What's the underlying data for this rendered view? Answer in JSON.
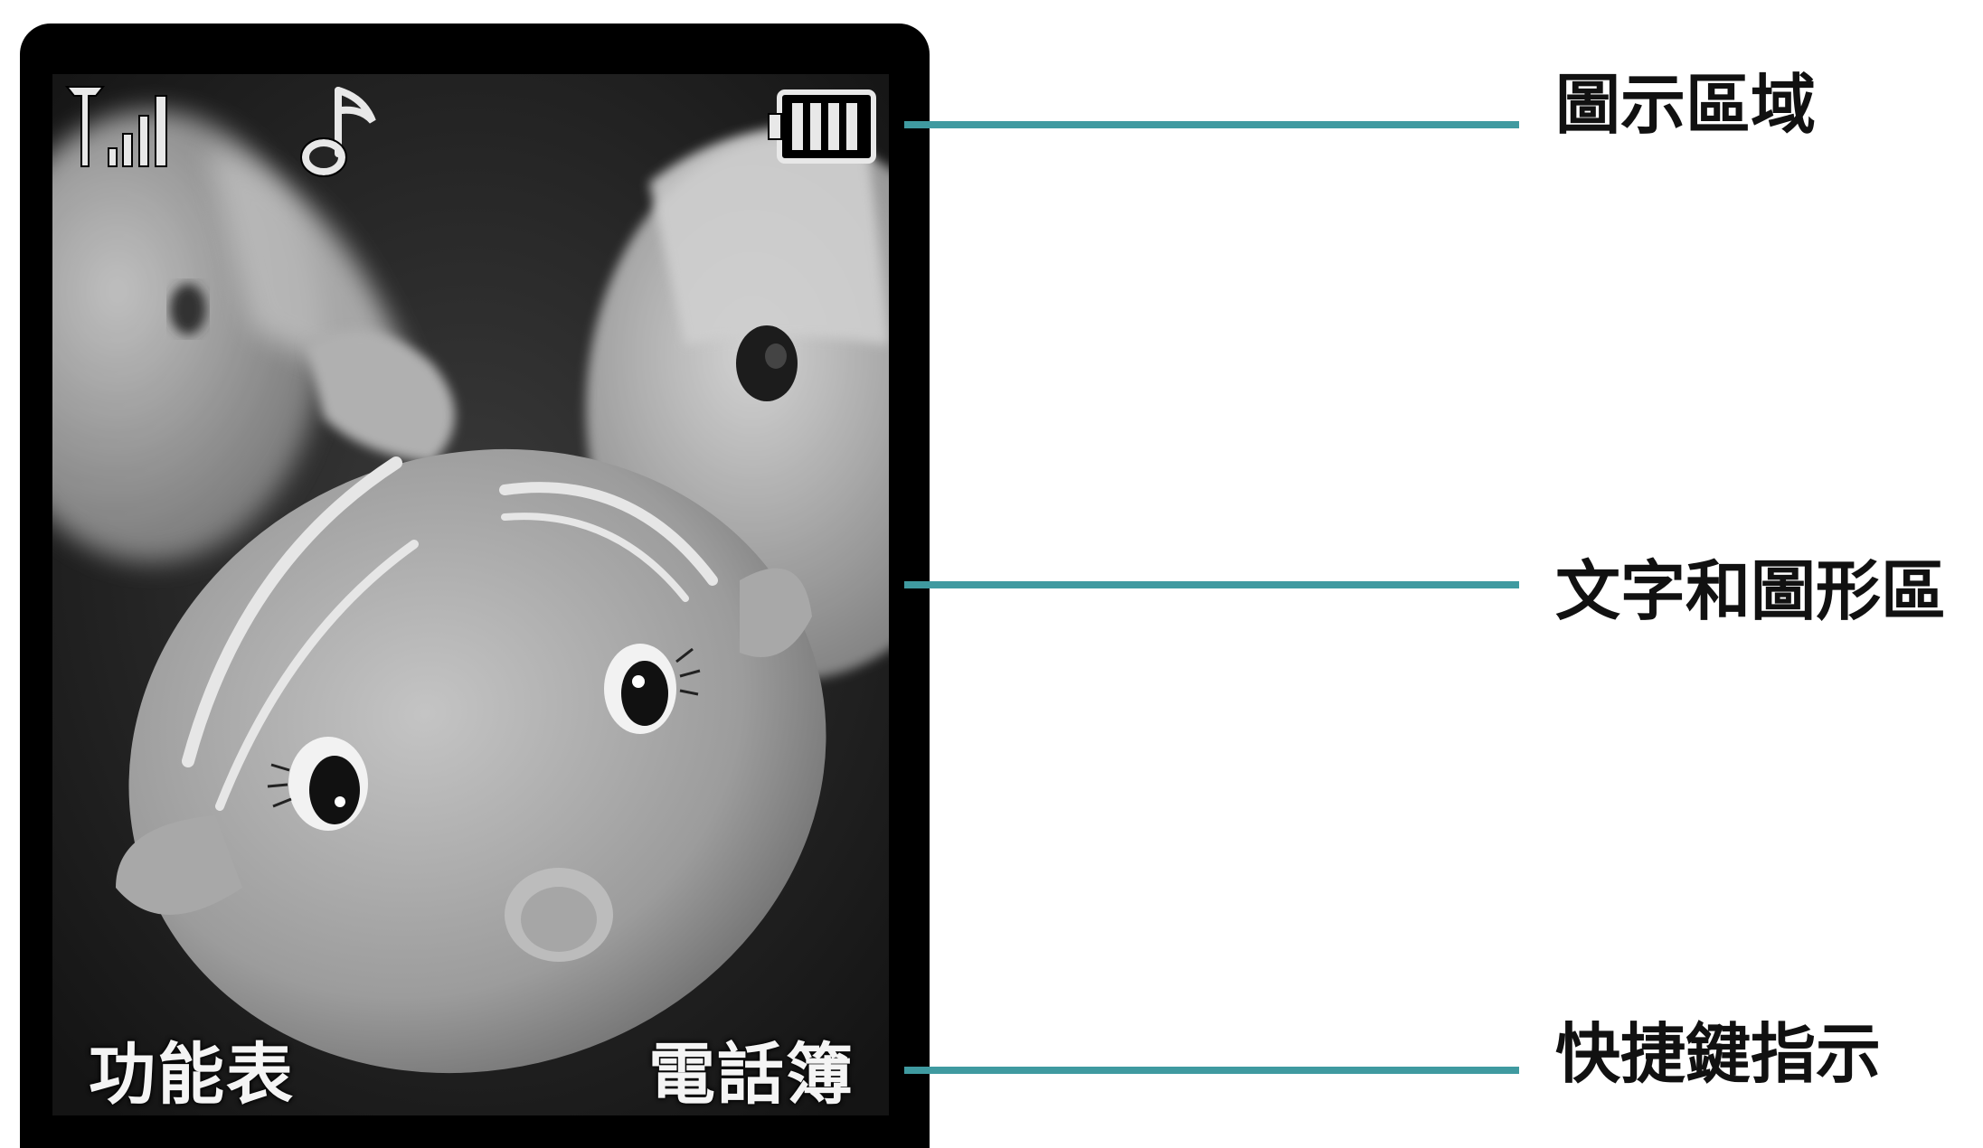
{
  "status_bar": {
    "signal_icon": "signal-strength-icon",
    "ringtone_icon": "music-note-icon",
    "battery_icon": "battery-full-icon"
  },
  "wallpaper": {
    "subject": "wallpaper-image"
  },
  "softkeys": {
    "left_label": "功能表",
    "right_label": "電話簿"
  },
  "callouts": {
    "icon_area": "圖示區域",
    "text_graphics_area": "文字和圖形區",
    "softkey_indicator": "快捷鍵指示"
  },
  "colors": {
    "frame": "#000000",
    "leader_line": "#3f9aa0",
    "softkey_text": "#f4f4f4"
  }
}
